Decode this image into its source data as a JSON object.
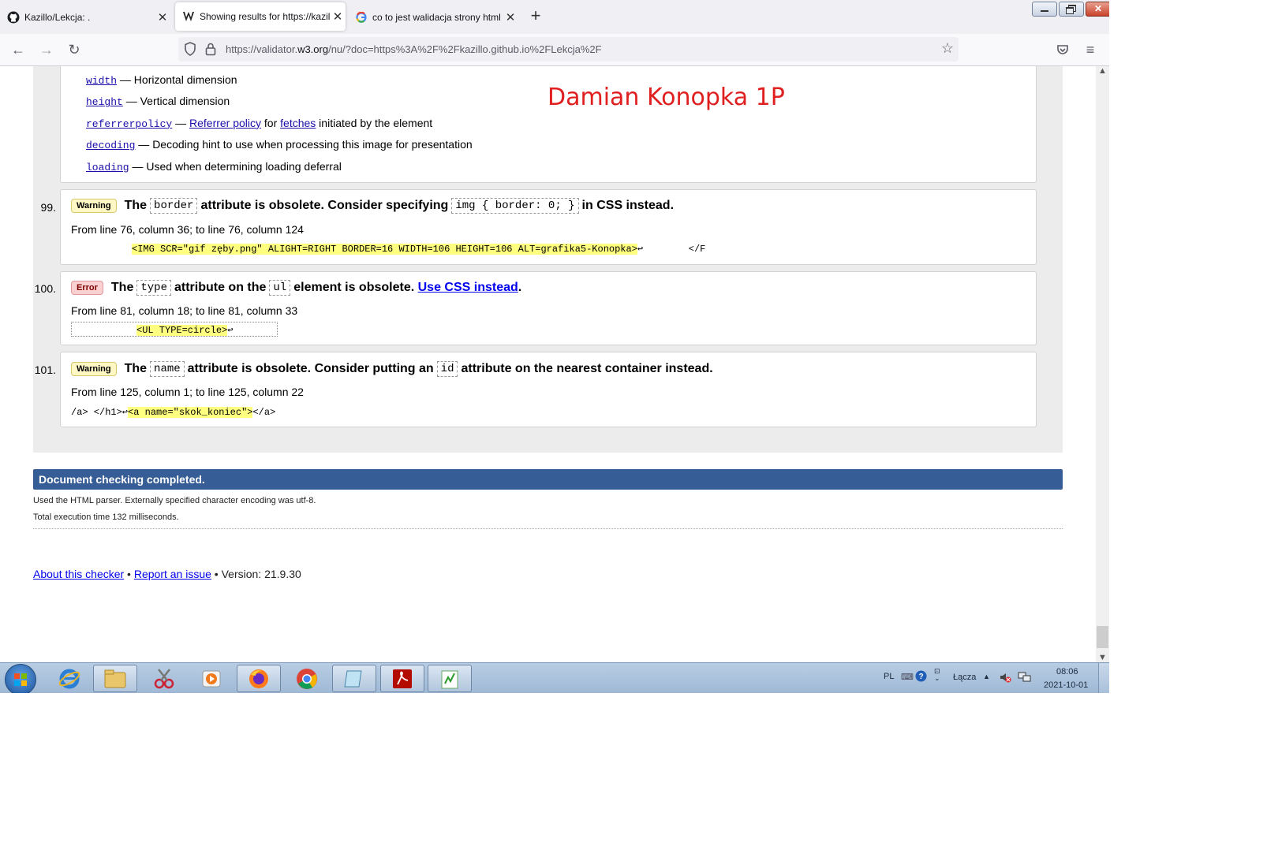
{
  "browser": {
    "tabs": [
      {
        "title": "Kazillo/Lekcja: .",
        "active": false
      },
      {
        "title": "Showing results for https://kazil",
        "active": true
      },
      {
        "title": "co to jest walidacja strony html",
        "active": false
      }
    ],
    "url_prefix": "https://validator.",
    "url_domain": "w3.org",
    "url_suffix": "/nu/?doc=https%3A%2F%2Fkazillo.github.io%2FLekcja%2F"
  },
  "annotation": "Damian Konopka 1P",
  "attributes": [
    {
      "name": "width",
      "desc": " — Horizontal dimension"
    },
    {
      "name": "height",
      "desc": " — Vertical dimension"
    },
    {
      "name": "referrerpolicy",
      "desc_parts": [
        " — ",
        "Referrer policy",
        " for ",
        "fetches",
        " initiated by the element"
      ]
    },
    {
      "name": "decoding",
      "desc": " — Decoding hint to use when processing this image for presentation"
    },
    {
      "name": "loading",
      "desc": " — Used when determining loading deferral"
    }
  ],
  "messages": [
    {
      "number": "99.",
      "type": "Warning",
      "parts": [
        "The",
        "border",
        "attribute is obsolete. Consider specifying",
        "img { border: 0; }",
        "in CSS instead."
      ],
      "location": "From line 76, column 36; to line 76, column 124",
      "extract_highlight": "<IMG SCR=\"gif zęby.png\" ALIGHT=RIGHT BORDER=16 WIDTH=106 HEIGHT=106 ALT=grafika5-Konopka>",
      "extract_after": "↩        </F"
    },
    {
      "number": "100.",
      "type": "Error",
      "parts": [
        "The",
        "type",
        "attribute on the",
        "ul",
        "element is obsolete.",
        "Use CSS instead",
        "."
      ],
      "location": "From line 81, column 18; to line 81, column 33",
      "extract_highlight": "<UL TYPE=circle>",
      "extract_after": "↩"
    },
    {
      "number": "101.",
      "type": "Warning",
      "parts": [
        "The",
        "name",
        "attribute is obsolete. Consider putting an",
        "id",
        "attribute on the nearest container instead."
      ],
      "location": "From line 125, column 1; to line 125, column 22",
      "extract_before": "/a> </h1>↩",
      "extract_highlight": "<a name=\"skok_koniec\">",
      "extract_after": "</a>"
    }
  ],
  "summary": {
    "title": "Document checking completed.",
    "parser_line": "Used the HTML parser. Externally specified character encoding was utf-8.",
    "time_line": "Total execution time 132 milliseconds."
  },
  "footer": {
    "about": "About this checker",
    "sep": " • ",
    "report": "Report an issue",
    "version": " • Version: 21.9.30"
  },
  "taskbar": {
    "lang": "PL",
    "network_label": "Łącza",
    "time": "08:06",
    "date": "2021-10-01"
  }
}
